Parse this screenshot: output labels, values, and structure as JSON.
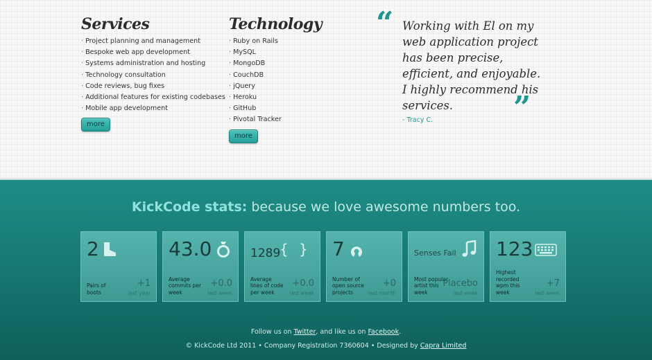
{
  "services": {
    "title": "Services",
    "items": [
      "Project planning and management",
      "Bespoke web app development",
      "Systems administration and hosting",
      "Technology consultation",
      "Code reviews, bug fixes",
      "Additional features for existing codebases",
      "Mobile app development"
    ],
    "more_label": "more"
  },
  "technology": {
    "title": "Technology",
    "items": [
      "Ruby on Rails",
      "MySQL",
      "MongoDB",
      "CouchDB",
      "jQuery",
      "Heroku",
      "GitHub",
      "Pivotal Tracker"
    ],
    "more_label": "more"
  },
  "testimonial": {
    "open_quote": "“",
    "close_quote": "”",
    "text": "Working with El on my web application project has been precise, efficient, and enjoyable. I highly recommend his services.",
    "author": "- Tracy C."
  },
  "stats": {
    "heading_brand": "KickCode stats:",
    "heading_rest": " because we love awesome numbers too.",
    "cards": [
      {
        "number": "2",
        "icon": "boot-icon",
        "label": "Pairs of boots",
        "value": "+1",
        "period": "last year"
      },
      {
        "number": "43.0",
        "icon": "ring-icon",
        "label": "Average commits per week",
        "value": "+0.0",
        "period": "last week"
      },
      {
        "number": "1289",
        "icon": "curly-braces-icon",
        "label": "Average lines of code per week",
        "value": "+0.0",
        "period": "last week"
      },
      {
        "number": "7",
        "icon": "open-source-icon",
        "label": "Number of open source projects",
        "value": "+0",
        "period": "last month"
      },
      {
        "number": "Senses Fail",
        "icon": "music-note-icon",
        "label": "Most popular artist this week",
        "value": "Placebo",
        "period": "last week"
      },
      {
        "number": "123",
        "icon": "keyboard-icon",
        "label": "Highest recorded wpm this week",
        "value": "+7",
        "period": "last week"
      }
    ]
  },
  "footer": {
    "follow_prefix": "Follow us on ",
    "twitter_label": "Twitter",
    "follow_middle": ", and like us on ",
    "facebook_label": "Facebook",
    "follow_suffix": ".",
    "copyright": "© KickCode Ltd 2011 • Company Registration 7360604 • Designed by ",
    "designer_label": "Capra Limited"
  },
  "colors": {
    "accent": "#1e958d",
    "stats_bg": "#187c76",
    "card_bg": "#4aa9a3"
  }
}
